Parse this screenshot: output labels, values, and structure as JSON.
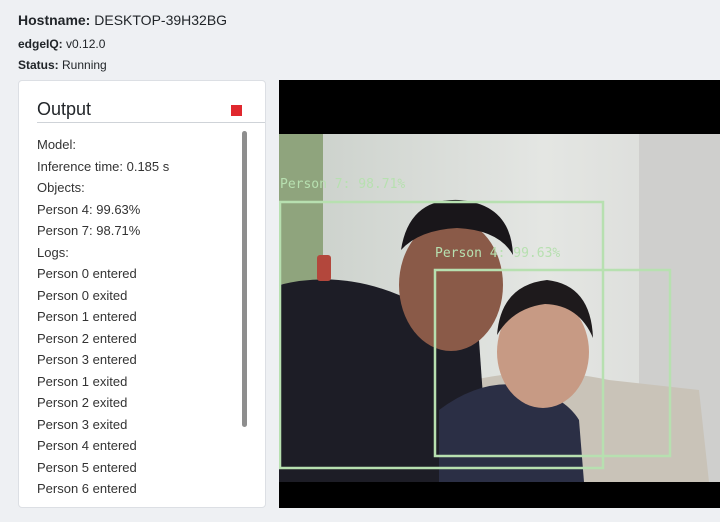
{
  "info": {
    "hostname_label": "Hostname:",
    "hostname": "DESKTOP-39H32BG",
    "version_label": "edgeIQ:",
    "version": "v0.12.0",
    "status_label": "Status:",
    "status": "Running"
  },
  "output": {
    "title": "Output",
    "stop_color": "#e0282e",
    "lines": [
      "Model:",
      "Inference time: 0.185 s",
      "Objects:",
      "Person 4: 99.63%",
      "Person 7: 98.71%",
      "Logs:",
      "Person 0 entered",
      "Person 0 exited",
      "Person 1 entered",
      "Person 2 entered",
      "Person 3 entered",
      "Person 1 exited",
      "Person 2 exited",
      "Person 3 exited",
      "Person 4 entered",
      "Person 5 entered",
      "Person 6 entered"
    ]
  },
  "video": {
    "box_color": "#b7e0b0",
    "detections": [
      {
        "label": "Person 7: 98.71%"
      },
      {
        "label": "Person 4: 99.63%"
      }
    ]
  }
}
